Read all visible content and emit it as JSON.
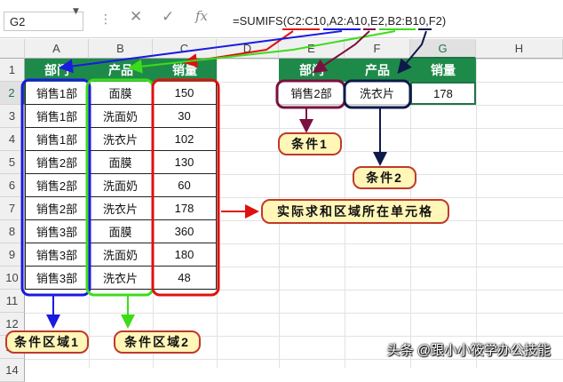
{
  "name_box": "G2",
  "formula_icons": {
    "cancel": "✕",
    "confirm": "✓",
    "fx": "fx"
  },
  "formula": "=SUMIFS(C2:C10,A2:A10,E2,B2:B10,F2)",
  "columns": [
    "A",
    "B",
    "C",
    "D",
    "E",
    "F",
    "G",
    "H"
  ],
  "rows": [
    "1",
    "2",
    "3",
    "4",
    "5",
    "6",
    "7",
    "8",
    "9",
    "10",
    "11",
    "12",
    "13",
    "14"
  ],
  "table1": {
    "headers": [
      "部门",
      "产品",
      "销量"
    ],
    "rows": [
      [
        "销售1部",
        "面膜",
        "150"
      ],
      [
        "销售1部",
        "洗面奶",
        "30"
      ],
      [
        "销售1部",
        "洗衣片",
        "102"
      ],
      [
        "销售2部",
        "面膜",
        "130"
      ],
      [
        "销售2部",
        "洗面奶",
        "60"
      ],
      [
        "销售2部",
        "洗衣片",
        "178"
      ],
      [
        "销售3部",
        "面膜",
        "360"
      ],
      [
        "销售3部",
        "洗面奶",
        "180"
      ],
      [
        "销售3部",
        "洗衣片",
        "48"
      ]
    ]
  },
  "table2": {
    "headers": [
      "部门",
      "产品",
      "销量"
    ],
    "row": [
      "销售2部",
      "洗衣片",
      "178"
    ]
  },
  "callouts": {
    "cond1": "条件1",
    "cond2": "条件2",
    "sum_range": "实际求和区域所在单元格",
    "range1": "条件区域1",
    "range2": "条件区域2"
  },
  "watermark": "头条 @跟小小筱学办公技能",
  "colors": {
    "header_green": "#1e8a4a",
    "callout_fill": "#fff6b8",
    "red": "#e01010",
    "blue": "#1a1ae0",
    "green": "#3ddc1a",
    "purple": "#7a1040",
    "navy": "#0e1a4a"
  }
}
